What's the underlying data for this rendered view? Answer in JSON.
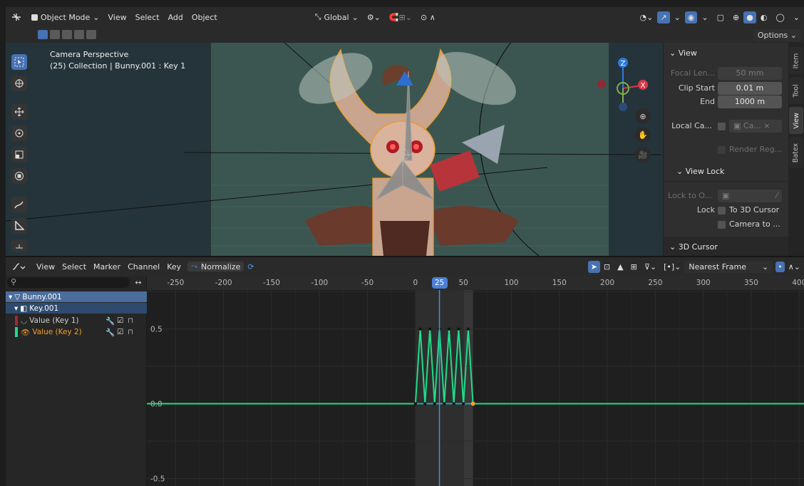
{
  "viewport_header": {
    "mode": "Object Mode",
    "menus": [
      "View",
      "Select",
      "Add",
      "Object"
    ],
    "orientation": "Global",
    "options_label": "Options"
  },
  "viewport_overlay": {
    "line1": "Camera Perspective",
    "line2": "(25) Collection | Bunny.001 : Key 1"
  },
  "gizmo": {
    "z": "Z",
    "x": "X"
  },
  "npanel": {
    "view_section": "View",
    "focal_length_label": "Focal Len...",
    "focal_length_value": "50 mm",
    "clip_start_label": "Clip Start",
    "clip_start_value": "0.01 m",
    "clip_end_label": "End",
    "clip_end_value": "1000 m",
    "local_camera_label": "Local Ca...",
    "local_camera_value": "Ca...",
    "render_region_label": "Render Reg...",
    "view_lock_section": "View Lock",
    "lock_to_object_label": "Lock to O...",
    "lock_label": "Lock",
    "to_3d_cursor": "To 3D Cursor",
    "camera_to_view": "Camera to ...",
    "cursor_section": "3D Cursor",
    "tabs": [
      "Item",
      "Tool",
      "View",
      "Batex"
    ],
    "active_tab": "View"
  },
  "graph_header": {
    "menus": [
      "View",
      "Select",
      "Marker",
      "Channel",
      "Key"
    ],
    "normalize_label": "Normalize",
    "snap_value": "Nearest Frame"
  },
  "channels": {
    "search_placeholder": "",
    "object": "Bunny.001",
    "shapekey_block": "Key.001",
    "items": [
      {
        "label": "Value (Key 1)",
        "color": "#9c2b33",
        "active": false
      },
      {
        "label": "Value (Key 2)",
        "color": "#1fdc8a",
        "active": true
      }
    ]
  },
  "timeline": {
    "ticks": [
      -250,
      -200,
      -150,
      -100,
      -50,
      0,
      50,
      100,
      150,
      200,
      250,
      300,
      350,
      400
    ],
    "tick_labels": [
      "-250",
      "-200",
      "-150",
      "-100",
      "-50",
      "0",
      "50",
      "100",
      "150",
      "200",
      "250",
      "300",
      "350",
      "400"
    ],
    "current_frame": "25",
    "y_labels": [
      "0.5",
      "0.0",
      "-0.5"
    ]
  },
  "chart_data": {
    "type": "line",
    "x_range": [
      -280,
      405
    ],
    "y_range": [
      -0.55,
      0.76
    ],
    "series": [
      {
        "name": "Value (Key 2)",
        "color": "#1fdc8a",
        "points": [
          [
            -280,
            0
          ],
          [
            0,
            0
          ],
          [
            5,
            0.5
          ],
          [
            10,
            0
          ],
          [
            15,
            0.5
          ],
          [
            20,
            0
          ],
          [
            25,
            0.5
          ],
          [
            30,
            0
          ],
          [
            35,
            0.5
          ],
          [
            40,
            0
          ],
          [
            45,
            0.5
          ],
          [
            50,
            0
          ],
          [
            55,
            0.5
          ],
          [
            60,
            0
          ],
          [
            405,
            0
          ]
        ]
      },
      {
        "name": "Value (Key 1)",
        "color": "#2aa6a0",
        "points": [
          [
            -280,
            0
          ],
          [
            405,
            0
          ]
        ]
      }
    ]
  }
}
